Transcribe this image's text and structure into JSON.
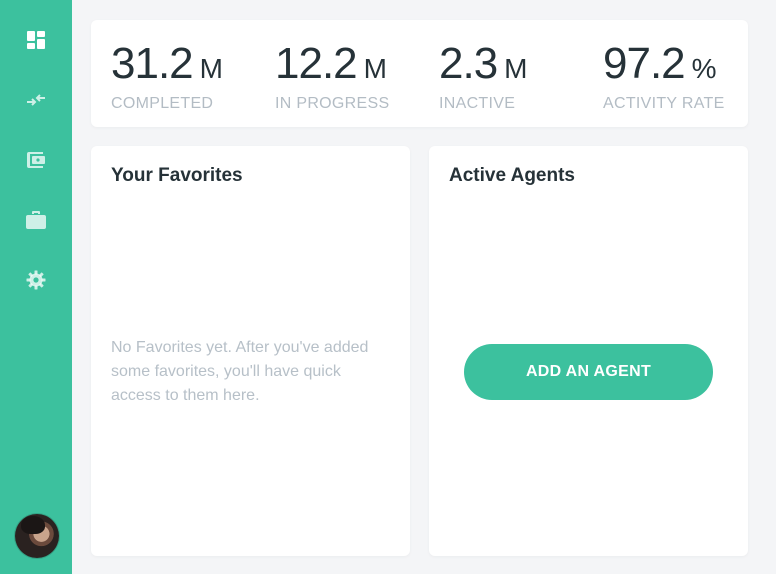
{
  "sidebar": {
    "items": [
      {
        "icon": "dashboard-icon"
      },
      {
        "icon": "transfer-arrows-icon"
      },
      {
        "icon": "wallet-icon"
      },
      {
        "icon": "briefcase-icon"
      },
      {
        "icon": "gear-icon"
      }
    ],
    "avatar": "user-avatar"
  },
  "stats": [
    {
      "value": "31.2",
      "unit": "M",
      "label": "COMPLETED"
    },
    {
      "value": "12.2",
      "unit": "M",
      "label": "IN PROGRESS"
    },
    {
      "value": "2.3",
      "unit": "M",
      "label": "INACTIVE"
    },
    {
      "value": "97.2",
      "unit": "%",
      "label": "ACTIVITY RATE"
    }
  ],
  "favorites": {
    "title": "Your Favorites",
    "empty_text": "No Favorites yet. After you've added some favorites, you'll have quick access to them here."
  },
  "agents": {
    "title": "Active Agents",
    "add_button": "ADD AN AGENT"
  },
  "colors": {
    "accent": "#3cc19e",
    "text_dark": "#263238",
    "text_muted": "#b3bcc4",
    "background": "#f4f5f7"
  }
}
